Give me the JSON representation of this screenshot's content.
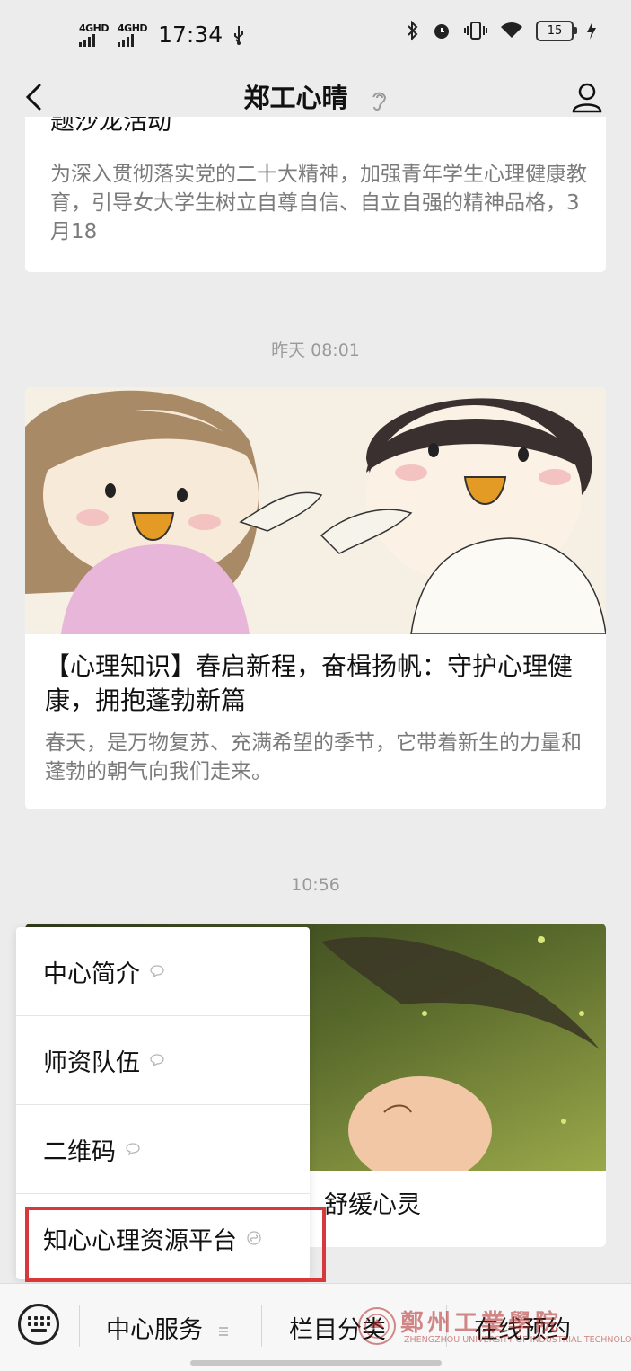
{
  "status_bar": {
    "signal1": "4GHD",
    "signal2": "4GHD",
    "time": "17:34",
    "battery": "15"
  },
  "nav": {
    "title": "郑工心晴"
  },
  "feed": {
    "article1": {
      "title_partial": "题沙龙活动",
      "desc": "为深入贯彻落实党的二十大精神，加强青年学生心理健康教育，引导女大学生树立自尊自信、自立自强的精神品格，3月18"
    },
    "timestamp1": "昨天 08:01",
    "article2": {
      "title": "【心理知识】春启新程，奋楫扬帆：守护心理健康，拥抱蓬勃新篇",
      "desc": "春天，是万物复苏、充满希望的季节，它带着新生的力量和蓬勃的朝气向我们走来。"
    },
    "timestamp2": "10:56",
    "article3": {
      "title_partial": "舒缓心灵"
    }
  },
  "menu": {
    "items": [
      {
        "label": "中心简介",
        "icon": "chat-bubble-icon"
      },
      {
        "label": "师资队伍",
        "icon": "chat-bubble-icon"
      },
      {
        "label": "二维码",
        "icon": "chat-bubble-icon"
      },
      {
        "label": "知心心理资源平台",
        "icon": "mini-program-icon"
      }
    ]
  },
  "bottom_bar": {
    "tabs": [
      {
        "label": "中心服务",
        "icon": "menu-lines-icon"
      },
      {
        "label": "栏目分类"
      },
      {
        "label": "在线预约"
      }
    ]
  },
  "watermark": {
    "text": "鄭州工業學院",
    "subtext": "ZHENGZHOU UNIVERSITY OF INDUSTRIAL TECHNOLOGY"
  },
  "colors": {
    "background": "#ececec",
    "card": "#ffffff",
    "highlight_border": "#d8383c"
  }
}
